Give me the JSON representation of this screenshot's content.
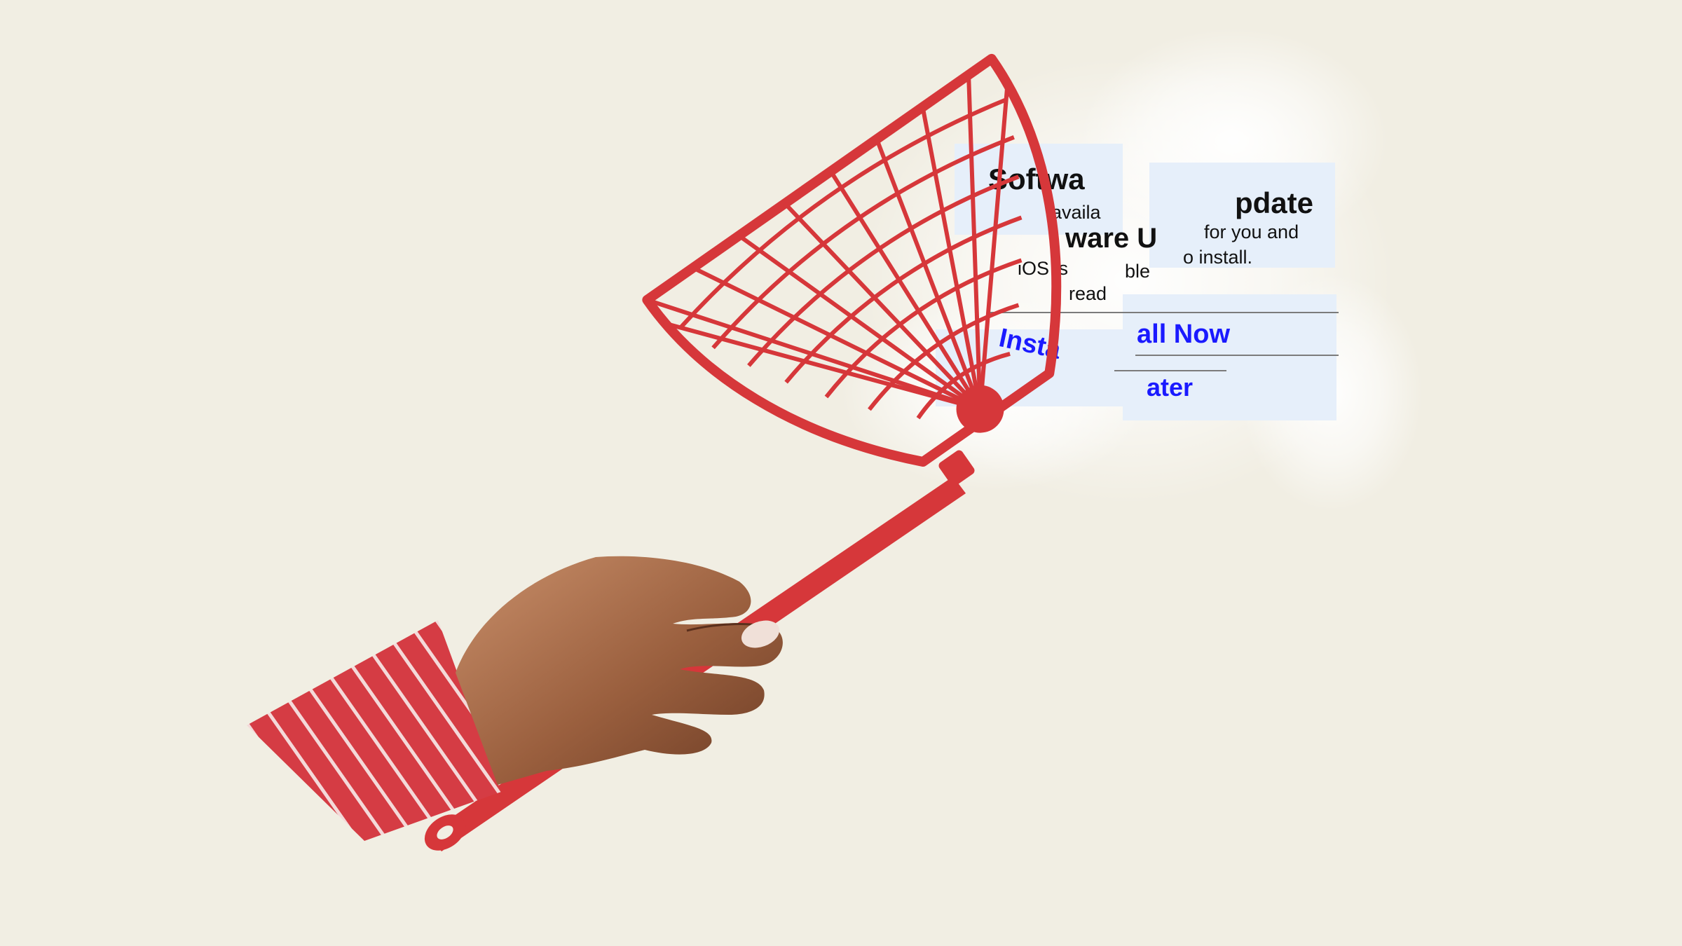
{
  "dialog": {
    "title_left": "Softwa",
    "title_right": "pdate",
    "subtitle_left": "ware U",
    "body_a": "availa",
    "body_b": "for you and",
    "body_c": "o install.",
    "body_d": "iOS is",
    "body_e": "ble",
    "body_f": "read",
    "action_left": "Insta",
    "action_right_top": "all Now",
    "action_right_bottom": "ater"
  },
  "colors": {
    "background": "#f1eee3",
    "swatter_red": "#d9383a",
    "dialog_bg": "#e6effa",
    "link_blue": "#1a1aff"
  }
}
